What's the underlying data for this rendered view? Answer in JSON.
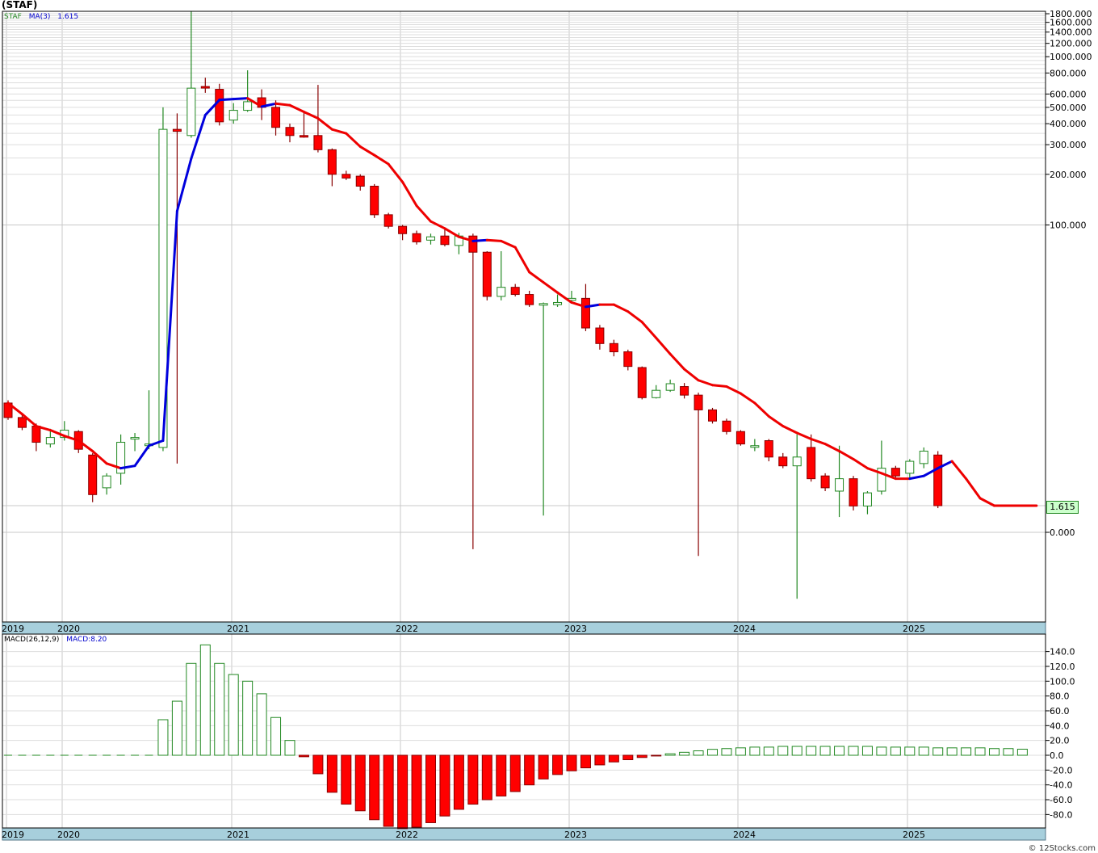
{
  "header": {
    "title": "(STAF)",
    "footer": "© 12Stocks.com"
  },
  "price_legend": {
    "symbol": "STAF",
    "ma_label": "MA(3)",
    "ma_value": "1.615"
  },
  "macd_legend": {
    "params": "MACD(26,12,9)",
    "value": "MACD:8.20"
  },
  "last_price": "1.615",
  "colors": {
    "up": "#228822",
    "down": "#ff0000",
    "down_wick": "#880000",
    "ma_up": "#0000dd",
    "ma_down": "#ee0000",
    "axis_band": "#a7cfdc",
    "grid": "#c8c8c8"
  },
  "x_axis_labels": [
    "2019",
    "2020",
    "2021",
    "2022",
    "2023",
    "2024",
    "2025"
  ],
  "chart_data": [
    {
      "type": "candlestick",
      "title": "(STAF)",
      "yscale": "log",
      "y_tick_labels": [
        "1800.000",
        "1600.000",
        "1400.000",
        "1200.000",
        "1000.000",
        "800.000",
        "600.000",
        "500.000",
        "400.000",
        "300.000",
        "200.000",
        "100.000",
        "1.615",
        "0.000"
      ],
      "candles": [
        {
          "date": "2019-12",
          "o": 7.3,
          "h": 7.6,
          "l": 5.7,
          "c": 5.9
        },
        {
          "date": "2020-01",
          "o": 5.9,
          "h": 6.3,
          "l": 4.9,
          "c": 5.1
        },
        {
          "date": "2020-02",
          "o": 5.2,
          "h": 5.4,
          "l": 3.6,
          "c": 4.1
        },
        {
          "date": "2020-03",
          "o": 4.0,
          "h": 5.0,
          "l": 3.8,
          "c": 4.4
        },
        {
          "date": "2020-04",
          "o": 4.4,
          "h": 5.6,
          "l": 4.2,
          "c": 4.9
        },
        {
          "date": "2020-05",
          "o": 4.8,
          "h": 4.9,
          "l": 3.5,
          "c": 3.7
        },
        {
          "date": "2020-06",
          "o": 3.4,
          "h": 3.5,
          "l": 1.7,
          "c": 1.9
        },
        {
          "date": "2020-07",
          "o": 2.1,
          "h": 2.6,
          "l": 1.9,
          "c": 2.5
        },
        {
          "date": "2020-08",
          "o": 2.6,
          "h": 4.6,
          "l": 2.2,
          "c": 4.1
        },
        {
          "date": "2020-09",
          "o": 4.3,
          "h": 4.7,
          "l": 3.6,
          "c": 4.4
        },
        {
          "date": "2020-10",
          "o": 3.9,
          "h": 8.8,
          "l": 3.7,
          "c": 4.0
        },
        {
          "date": "2020-11",
          "o": 3.8,
          "h": 500,
          "l": 3.6,
          "c": 370
        },
        {
          "date": "2020-12",
          "o": 370,
          "h": 460,
          "l": 3.0,
          "c": 360
        },
        {
          "date": "2021-01",
          "o": 340,
          "h": 1850,
          "l": 330,
          "c": 650
        },
        {
          "date": "2021-02",
          "o": 665,
          "h": 750,
          "l": 610,
          "c": 660
        },
        {
          "date": "2021-03",
          "o": 640,
          "h": 690,
          "l": 390,
          "c": 410
        },
        {
          "date": "2021-04",
          "o": 420,
          "h": 530,
          "l": 400,
          "c": 480
        },
        {
          "date": "2021-05",
          "o": 480,
          "h": 830,
          "l": 470,
          "c": 540
        },
        {
          "date": "2021-06",
          "o": 570,
          "h": 640,
          "l": 420,
          "c": 500
        },
        {
          "date": "2021-07",
          "o": 500,
          "h": 550,
          "l": 340,
          "c": 380
        },
        {
          "date": "2021-08",
          "o": 380,
          "h": 400,
          "l": 310,
          "c": 340
        },
        {
          "date": "2021-09",
          "o": 340,
          "h": 470,
          "l": 330,
          "c": 335
        },
        {
          "date": "2021-10",
          "o": 340,
          "h": 680,
          "l": 270,
          "c": 280
        },
        {
          "date": "2021-11",
          "o": 280,
          "h": 285,
          "l": 170,
          "c": 200
        },
        {
          "date": "2021-12",
          "o": 200,
          "h": 210,
          "l": 185,
          "c": 190
        },
        {
          "date": "2022-01",
          "o": 195,
          "h": 200,
          "l": 160,
          "c": 170
        },
        {
          "date": "2022-02",
          "o": 170,
          "h": 175,
          "l": 110,
          "c": 115
        },
        {
          "date": "2022-03",
          "o": 115,
          "h": 118,
          "l": 95,
          "c": 98
        },
        {
          "date": "2022-04",
          "o": 98,
          "h": 100,
          "l": 80,
          "c": 88
        },
        {
          "date": "2022-05",
          "o": 88,
          "h": 92,
          "l": 75,
          "c": 78
        },
        {
          "date": "2022-06",
          "o": 80,
          "h": 88,
          "l": 75,
          "c": 84
        },
        {
          "date": "2022-07",
          "o": 85,
          "h": 95,
          "l": 73,
          "c": 75
        },
        {
          "date": "2022-08",
          "o": 74,
          "h": 89,
          "l": 65,
          "c": 85
        },
        {
          "date": "2022-09",
          "o": 85,
          "h": 88,
          "l": 0.44,
          "c": 67
        },
        {
          "date": "2022-10",
          "o": 67,
          "h": 68,
          "l": 33,
          "c": 35
        },
        {
          "date": "2022-11",
          "o": 35,
          "h": 68,
          "l": 33,
          "c": 40
        },
        {
          "date": "2022-12",
          "o": 40,
          "h": 42,
          "l": 35,
          "c": 36
        },
        {
          "date": "2023-01",
          "o": 36,
          "h": 38,
          "l": 30,
          "c": 31
        },
        {
          "date": "2023-02",
          "o": 31,
          "h": 32,
          "l": 1.2,
          "c": 31.5
        },
        {
          "date": "2023-03",
          "o": 31,
          "h": 36,
          "l": 30,
          "c": 32
        },
        {
          "date": "2023-04",
          "o": 33,
          "h": 38,
          "l": 32,
          "c": 34
        },
        {
          "date": "2023-05",
          "o": 34,
          "h": 42,
          "l": 21,
          "c": 22
        },
        {
          "date": "2023-06",
          "o": 22,
          "h": 23,
          "l": 16,
          "c": 17.5
        },
        {
          "date": "2023-07",
          "o": 17.5,
          "h": 18.5,
          "l": 14.5,
          "c": 15.5
        },
        {
          "date": "2023-08",
          "o": 15.5,
          "h": 16,
          "l": 11.8,
          "c": 12.5
        },
        {
          "date": "2023-09",
          "o": 12.3,
          "h": 12.5,
          "l": 7.7,
          "c": 7.9
        },
        {
          "date": "2023-10",
          "o": 7.9,
          "h": 9.5,
          "l": 7.8,
          "c": 8.8
        },
        {
          "date": "2023-11",
          "o": 8.8,
          "h": 10.3,
          "l": 8.6,
          "c": 9.7
        },
        {
          "date": "2023-12",
          "o": 9.3,
          "h": 9.8,
          "l": 7.8,
          "c": 8.2
        },
        {
          "date": "2023-12b",
          "o": 8.2,
          "h": 8.5,
          "l": 0.36,
          "c": 6.6
        },
        {
          "date": "2024-01",
          "o": 6.6,
          "h": 6.8,
          "l": 5.4,
          "c": 5.6
        },
        {
          "date": "2024-02",
          "o": 5.6,
          "h": 5.8,
          "l": 4.6,
          "c": 4.8
        },
        {
          "date": "2024-03",
          "o": 4.8,
          "h": 4.9,
          "l": 3.9,
          "c": 4.0
        },
        {
          "date": "2024-04",
          "o": 3.9,
          "h": 4.3,
          "l": 3.6,
          "c": 3.9
        },
        {
          "date": "2024-05",
          "o": 4.2,
          "h": 4.3,
          "l": 3.1,
          "c": 3.3
        },
        {
          "date": "2024-06",
          "o": 3.3,
          "h": 3.5,
          "l": 2.8,
          "c": 2.9
        },
        {
          "date": "2024-07",
          "o": 2.9,
          "h": 4.6,
          "l": 0.1,
          "c": 3.3
        },
        {
          "date": "2024-08",
          "o": 3.8,
          "h": 4.6,
          "l": 2.3,
          "c": 2.4
        },
        {
          "date": "2024-09",
          "o": 2.5,
          "h": 2.6,
          "l": 2.0,
          "c": 2.1
        },
        {
          "date": "2024-10",
          "o": 2.0,
          "h": 3.9,
          "l": 1.15,
          "c": 2.4
        },
        {
          "date": "2024-11",
          "o": 2.4,
          "h": 2.5,
          "l": 1.4,
          "c": 1.6
        },
        {
          "date": "2024-12",
          "o": 1.6,
          "h": 2.0,
          "l": 1.25,
          "c": 1.95
        },
        {
          "date": "2024-12b",
          "o": 2.0,
          "h": 4.2,
          "l": 1.9,
          "c": 2.8
        },
        {
          "date": "2025-01",
          "o": 2.8,
          "h": 2.9,
          "l": 2.4,
          "c": 2.5
        },
        {
          "date": "2025-02",
          "o": 2.6,
          "h": 3.2,
          "l": 2.4,
          "c": 3.1
        },
        {
          "date": "2025-03",
          "o": 3.0,
          "h": 3.8,
          "l": 2.8,
          "c": 3.6
        },
        {
          "date": "2025-04",
          "o": 3.4,
          "h": 3.6,
          "l": 1.5,
          "c": 1.615
        }
      ],
      "ma3": {
        "name": "MA(3)",
        "values": [
          7.3,
          6.2,
          5.2,
          4.9,
          4.5,
          4.2,
          3.6,
          3.0,
          2.8,
          2.9,
          3.9,
          4.2,
          121,
          248,
          450,
          553,
          560,
          566,
          505,
          526,
          515,
          470,
          430,
          370,
          350,
          292,
          260,
          230,
          180,
          130,
          105,
          95,
          84,
          79,
          80,
          79,
          72,
          50,
          43,
          37,
          32,
          30,
          31,
          31,
          28,
          24,
          19,
          15,
          12,
          10.2,
          9.5,
          9.3,
          8.4,
          7.3,
          6.0,
          5.2,
          4.7,
          4.3,
          4.0,
          3.6,
          3.2,
          2.8,
          2.6,
          2.4,
          2.4,
          2.5,
          2.8,
          3.1,
          2.4,
          1.8,
          1.615,
          1.615,
          1.615,
          1.615
        ]
      },
      "ma_projection": {
        "value": 1.615,
        "through": "2025-07"
      }
    },
    {
      "type": "bar",
      "title": "MACD(26,12,9)",
      "ylim": [
        -95,
        150
      ],
      "y_tick_labels": [
        "140.0",
        "120.0",
        "100.0",
        "80.0",
        "60.0",
        "40.0",
        "20.0",
        "0.0",
        "-20.0",
        "-40.0",
        "-60.0",
        "-80.0"
      ],
      "values": [
        0,
        0,
        0,
        0,
        0,
        0,
        0,
        0,
        0,
        0,
        0,
        48,
        73,
        124,
        149,
        124,
        109,
        100,
        83,
        51,
        20,
        -2,
        -25,
        -50,
        -66,
        -75,
        -87,
        -96,
        -99,
        -97,
        -91,
        -82,
        -73,
        -66,
        -60,
        -55,
        -49,
        -40,
        -32,
        -26,
        -21,
        -17,
        -13,
        -9,
        -6,
        -3,
        -1,
        2,
        4,
        6,
        8,
        9,
        10,
        11,
        11,
        12,
        12,
        12,
        12,
        12,
        12,
        12,
        11,
        11,
        11,
        11,
        10,
        10,
        10,
        10,
        9,
        9,
        8.2
      ]
    }
  ]
}
